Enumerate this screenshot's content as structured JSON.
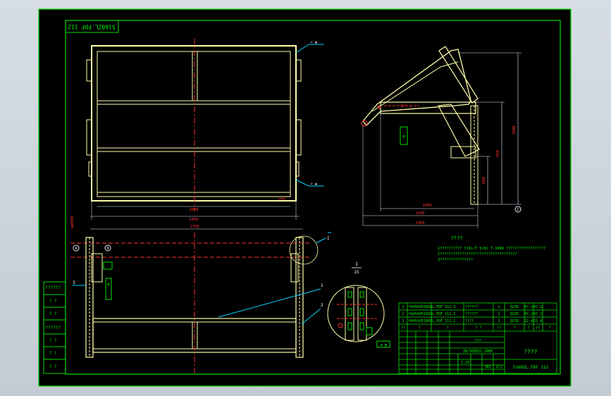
{
  "colors": {
    "viewport_bg": "#cbd3dc",
    "sheet_bg": "#000000",
    "border": "#00e000",
    "frame": "#ffffa8",
    "dim": "#e8e8ff",
    "center_line": "#ff3030",
    "leader": "#00d6ff",
    "text_green": "#00ff00",
    "text_white": "#ffffff"
  },
  "drawing": {
    "rotated_code": "5160ZL.FDF 112",
    "main_view": {
      "dim_inner": "2000",
      "dim_outer": "2400",
      "dim_front": "2700"
    },
    "side_view": {
      "dim_height_total": "1800",
      "dim_height_mid": "950",
      "dim_height_low": "600",
      "dim_base_inner": "1900",
      "dim_base_mid": "2100",
      "dim_base_outer": "2300"
    },
    "detail_label": "I",
    "detail_scale_top": "1",
    "detail_scale_bottom": "15",
    "balloons": [
      "1",
      "2",
      "3",
      "1",
      "I"
    ],
    "datum_a": "A",
    "datum_b": "B",
    "datum_c": "C",
    "notes_title": "????",
    "notes_lines": [
      "1?????????? 7(8)/T 5(8) T-1998 ??????????????????",
      "2???????????????????????????????????",
      "3???????????????"
    ],
    "left_stamp_rows": [
      "??????",
      "? ?",
      "? ?",
      "??????",
      "? ?",
      "? ?",
      "? ?"
    ]
  },
  "title_block": {
    "parts": [
      {
        "no": "3",
        "code": "%%U%%O5160ZL.FDF 112.3",
        "name": "??????",
        "qty": "1",
        "mat": "Q235",
        "weight": "47.2",
        "total": "47.2"
      },
      {
        "no": "2",
        "code": "%%U%%O5160ZL.FDF 112.2",
        "name": "??????",
        "qty": "1",
        "mat": "Q235",
        "weight": "47.2",
        "total": "47.2"
      },
      {
        "no": "1",
        "code": "%%U%%O5160ZL.FDF 112.1",
        "name": "????",
        "qty": "1",
        "mat": "Q235",
        "weight": "22.4",
        "total": "22.4"
      }
    ],
    "header": [
      "??",
      "?",
      "?",
      "? ?",
      "??",
      "?",
      "?",
      "??",
      "?",
      "?"
    ],
    "company": "???",
    "standard": "JB/SQ0031-2000",
    "drawing_title": "????",
    "scale": "1:10",
    "sheet": "1/1",
    "weight": "385",
    "drawing_no": "5160ZL.FDF 112"
  }
}
